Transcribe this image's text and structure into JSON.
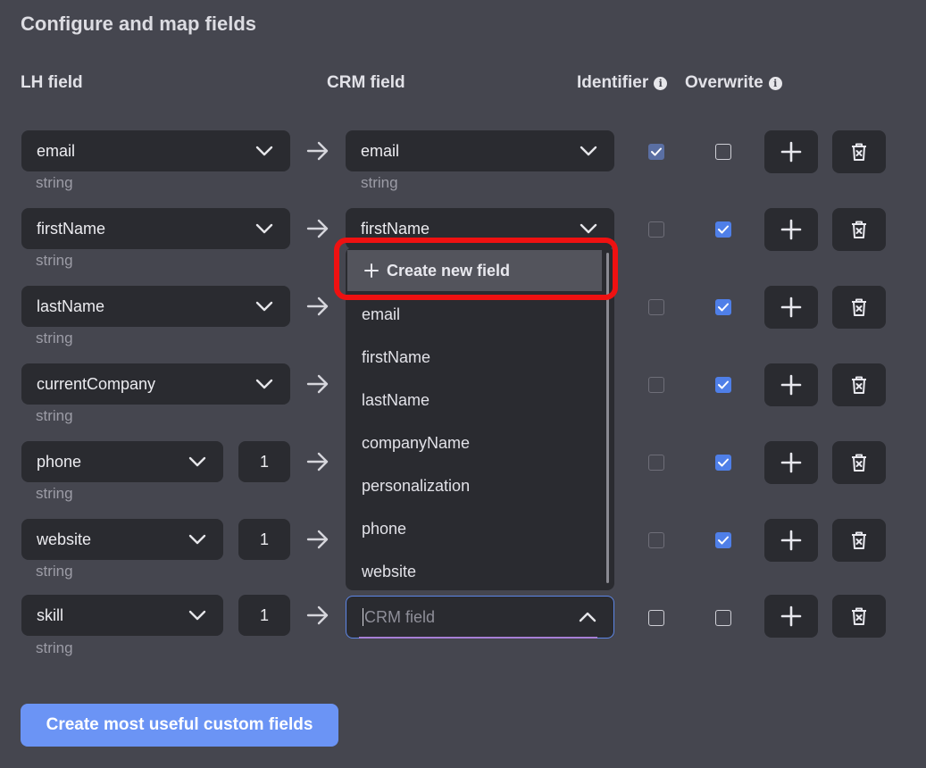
{
  "title": "Configure and map fields",
  "headers": {
    "lh_field": "LH field",
    "crm_field": "CRM field",
    "identifier": "Identifier",
    "overwrite": "Overwrite"
  },
  "rows": [
    {
      "lh": "email",
      "lh_type": "string",
      "index": "",
      "crm": "email",
      "crm_type": "string",
      "identifier": true,
      "identifier_disabled": true,
      "overwrite": false
    },
    {
      "lh": "firstName",
      "lh_type": "string",
      "index": "",
      "crm": "firstName",
      "crm_type": "",
      "identifier": false,
      "overwrite": true
    },
    {
      "lh": "lastName",
      "lh_type": "string",
      "index": "",
      "crm": "",
      "crm_type": "",
      "identifier": false,
      "overwrite": true
    },
    {
      "lh": "currentCompany",
      "lh_type": "string",
      "index": "",
      "crm": "",
      "crm_type": "",
      "identifier": false,
      "overwrite": true
    },
    {
      "lh": "phone",
      "lh_type": "string",
      "index": "1",
      "crm": "",
      "crm_type": "",
      "identifier": false,
      "overwrite": true
    },
    {
      "lh": "website",
      "lh_type": "string",
      "index": "1",
      "crm": "",
      "crm_type": "",
      "identifier": false,
      "overwrite": true
    },
    {
      "lh": "skill",
      "lh_type": "string",
      "index": "1",
      "crm": "",
      "crm_type": "",
      "identifier": false,
      "overwrite": false
    }
  ],
  "dropdown": {
    "create_label": "Create new field",
    "options": [
      "email",
      "firstName",
      "lastName",
      "companyName",
      "personalization",
      "phone",
      "website"
    ]
  },
  "crm_input": {
    "placeholder": "CRM field"
  },
  "primary_button": "Create most useful custom fields",
  "colors": {
    "accent": "#6b94f5",
    "highlight": "#ef1111",
    "background": "#45464f",
    "control": "#2a2b30"
  }
}
